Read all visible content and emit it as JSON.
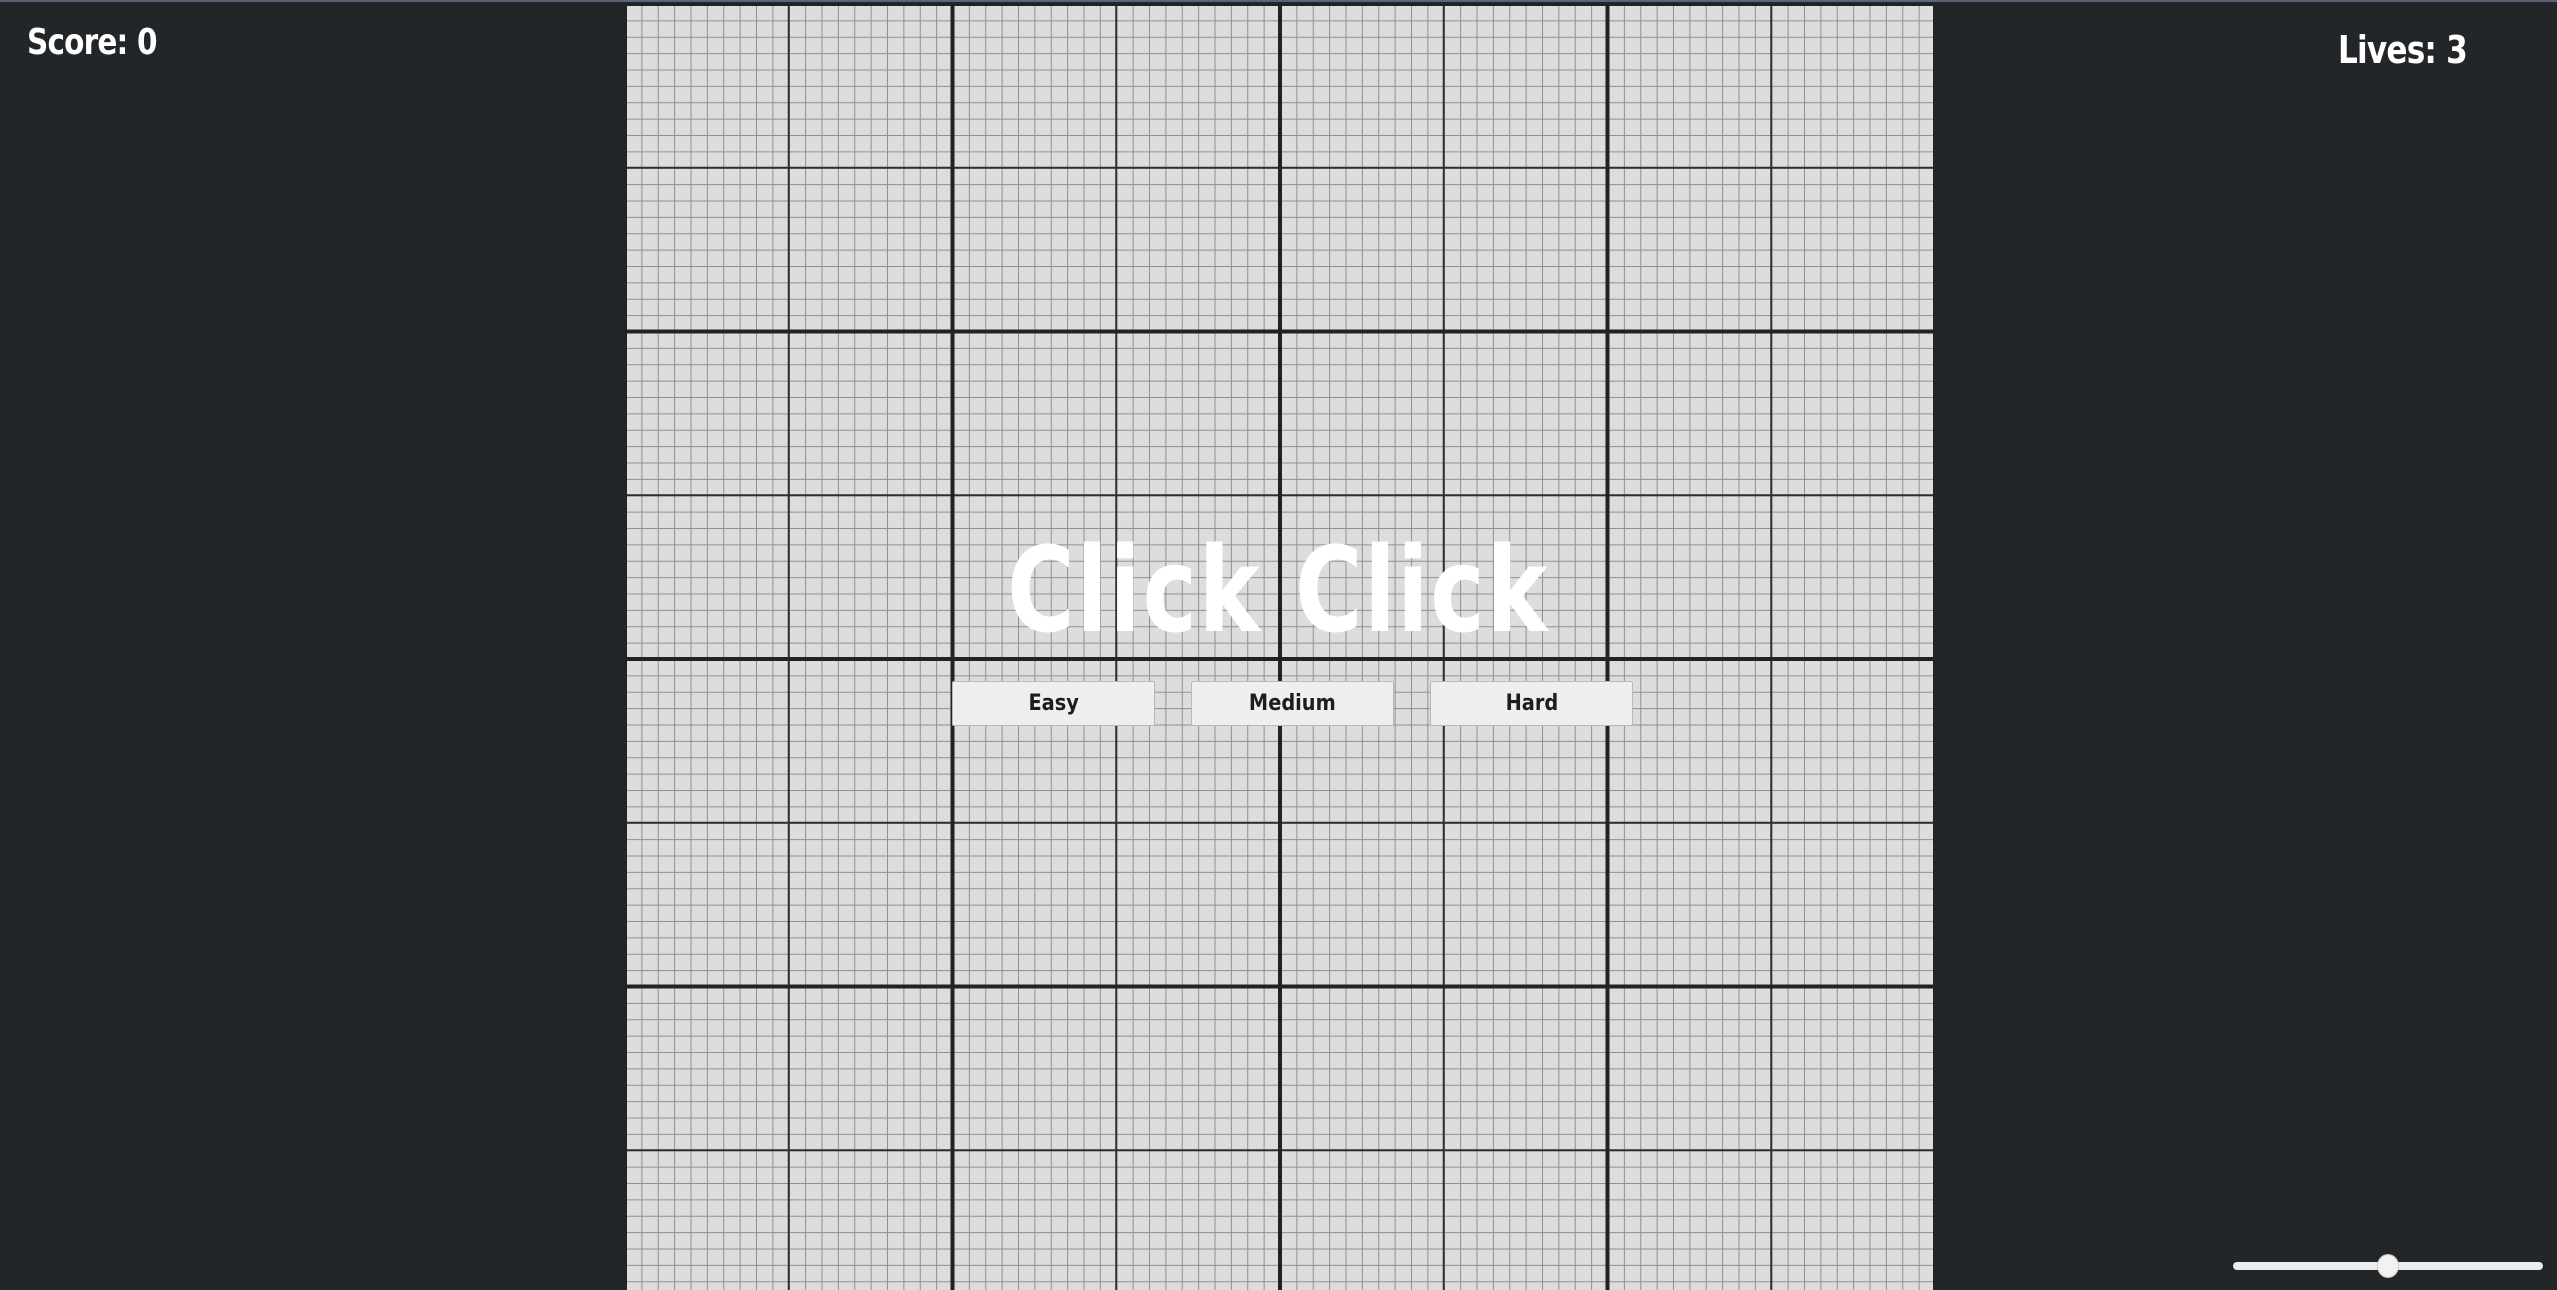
{
  "hud": {
    "score_label": "Score: 0",
    "lives_label": "Lives: 3"
  },
  "game": {
    "title": "Click Click"
  },
  "difficulty": {
    "easy_label": "Easy",
    "medium_label": "Medium",
    "hard_label": "Hard"
  },
  "volume_slider": {
    "value_fraction": 0.5
  },
  "colors": {
    "background": "#222629",
    "board": "#dddedb",
    "grid_major": "#1f2326",
    "text": "#ffffff",
    "button": "#efefef"
  }
}
